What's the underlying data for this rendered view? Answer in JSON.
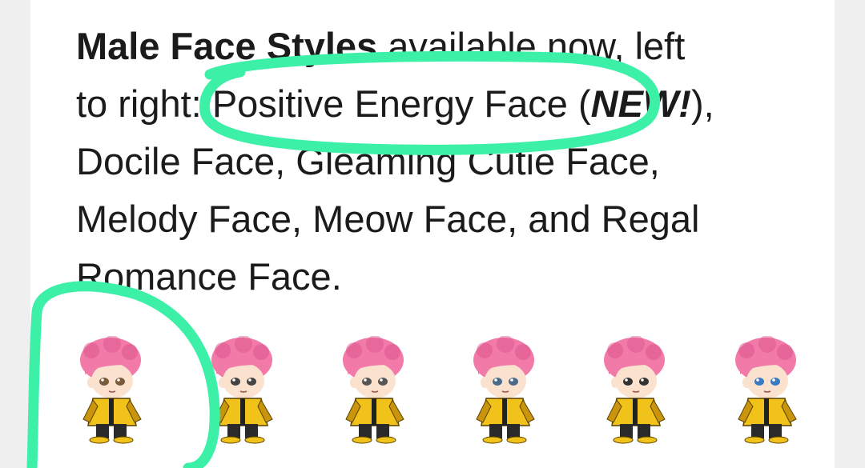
{
  "post": {
    "bold_title": "Male Face Styles",
    "line1_rest": " available now, left",
    "line2_a": "to right: ",
    "line2_highlight": "Positive Energy Face",
    "line2_b": " (",
    "line2_new": "NEW!",
    "line2_c": "),",
    "line3": "Docile Face, Gleaming Cutie Face,",
    "line4": "Melody Face, Meow Face, and Regal",
    "line5": "Romance Face."
  },
  "characters": [
    {
      "face": "Positive Energy Face",
      "eye_color": "#7a5a3a"
    },
    {
      "face": "Docile Face",
      "eye_color": "#444444"
    },
    {
      "face": "Gleaming Cutie Face",
      "eye_color": "#555555"
    },
    {
      "face": "Melody Face",
      "eye_color": "#4a6a8a"
    },
    {
      "face": "Meow Face",
      "eye_color": "#333333"
    },
    {
      "face": "Regal Romance Face",
      "eye_color": "#3a7ac0"
    }
  ],
  "colors": {
    "highlighter": "#3df0a8",
    "hair": "#f27aa8",
    "hair_shade": "#d9528a",
    "jacket": "#f0c21a",
    "jacket_shade": "#c9950c",
    "pants": "#2a2a2a",
    "skin": "#fbe2cf"
  }
}
